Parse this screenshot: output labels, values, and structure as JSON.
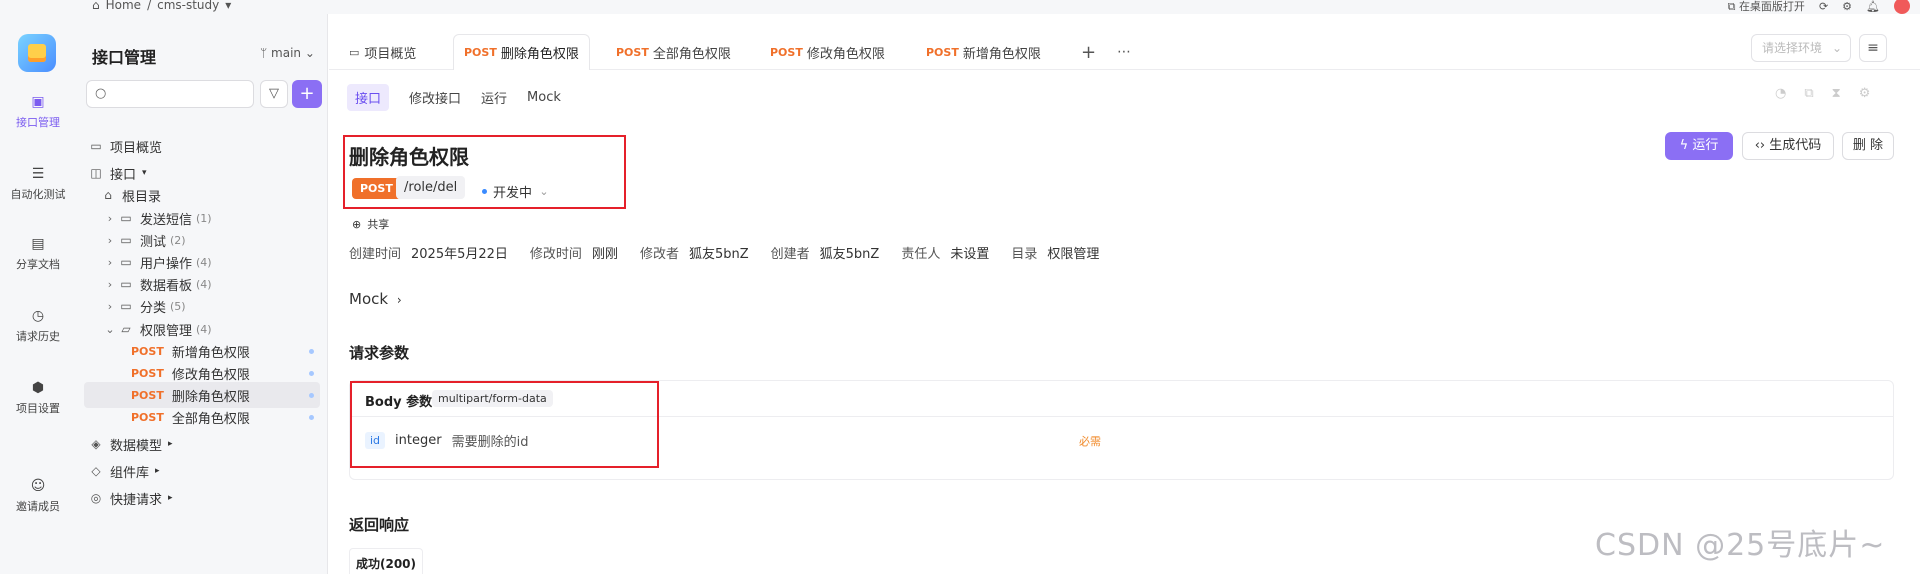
{
  "topbar": {
    "home": "Home",
    "separator": "/",
    "project": "cms-study",
    "open_desktop": "在桌面版打开"
  },
  "rail": {
    "items": [
      {
        "label": "接口管理",
        "icon": "api-icon",
        "active": true
      },
      {
        "label": "自动化测试",
        "icon": "layers-icon",
        "active": false
      },
      {
        "label": "分享文档",
        "icon": "book-icon",
        "active": false
      },
      {
        "label": "请求历史",
        "icon": "clock-icon",
        "active": false
      },
      {
        "label": "项目设置",
        "icon": "settings-icon",
        "active": false
      },
      {
        "label": "邀请成员",
        "icon": "invite-icon",
        "active": false
      }
    ]
  },
  "sidebar": {
    "title": "接口管理",
    "branch": "main",
    "tree": [
      {
        "label": "项目概览",
        "type": "overview"
      },
      {
        "label": "接口",
        "type": "section"
      },
      {
        "label": "根目录",
        "type": "root"
      },
      {
        "label": "发送短信",
        "count": "(1)",
        "type": "folder"
      },
      {
        "label": "测试",
        "count": "(2)",
        "type": "folder"
      },
      {
        "label": "用户操作",
        "count": "(4)",
        "type": "folder"
      },
      {
        "label": "数据看板",
        "count": "(4)",
        "type": "folder"
      },
      {
        "label": "分类",
        "count": "(5)",
        "type": "folder"
      },
      {
        "label": "权限管理",
        "count": "(4)",
        "type": "folder-open"
      },
      {
        "label": "新增角色权限",
        "method": "POST",
        "type": "api"
      },
      {
        "label": "修改角色权限",
        "method": "POST",
        "type": "api"
      },
      {
        "label": "删除角色权限",
        "method": "POST",
        "type": "api",
        "selected": true
      },
      {
        "label": "全部角色权限",
        "method": "POST",
        "type": "api"
      },
      {
        "label": "数据模型",
        "type": "section2"
      },
      {
        "label": "组件库",
        "type": "section2"
      },
      {
        "label": "快捷请求",
        "type": "section2"
      }
    ]
  },
  "tabs": [
    {
      "label": "项目概览",
      "method": ""
    },
    {
      "label": "删除角色权限",
      "method": "POST",
      "active": true
    },
    {
      "label": "全部角色权限",
      "method": "POST"
    },
    {
      "label": "修改角色权限",
      "method": "POST"
    },
    {
      "label": "新增角色权限",
      "method": "POST"
    }
  ],
  "env_placeholder": "请选择环境",
  "subtabs": [
    "接口",
    "修改接口",
    "运行",
    "Mock"
  ],
  "api": {
    "title": "删除角色权限",
    "method": "POST",
    "path": "/role/del",
    "status": "开发中",
    "share": "共享",
    "meta": [
      {
        "k": "创建时间",
        "v": "2025年5月22日"
      },
      {
        "k": "修改时间",
        "v": "刚刚"
      },
      {
        "k": "修改者",
        "v": "狐友5bnZ"
      },
      {
        "k": "创建者",
        "v": "狐友5bnZ"
      },
      {
        "k": "责任人",
        "v": "未设置"
      },
      {
        "k": "目录",
        "v": "权限管理"
      }
    ]
  },
  "actions": {
    "run": "运行",
    "gen_code": "生成代码",
    "delete": "删 除"
  },
  "mock": {
    "label": "Mock"
  },
  "request": {
    "heading": "请求参数",
    "body_title": "Body 参数",
    "content_type": "multipart/form-data",
    "param_name": "id",
    "param_type": "integer",
    "param_desc": "需要删除的id",
    "required": "必需"
  },
  "response": {
    "heading": "返回响应",
    "tab": "成功(200)"
  },
  "watermark": "CSDN @25号底片~"
}
